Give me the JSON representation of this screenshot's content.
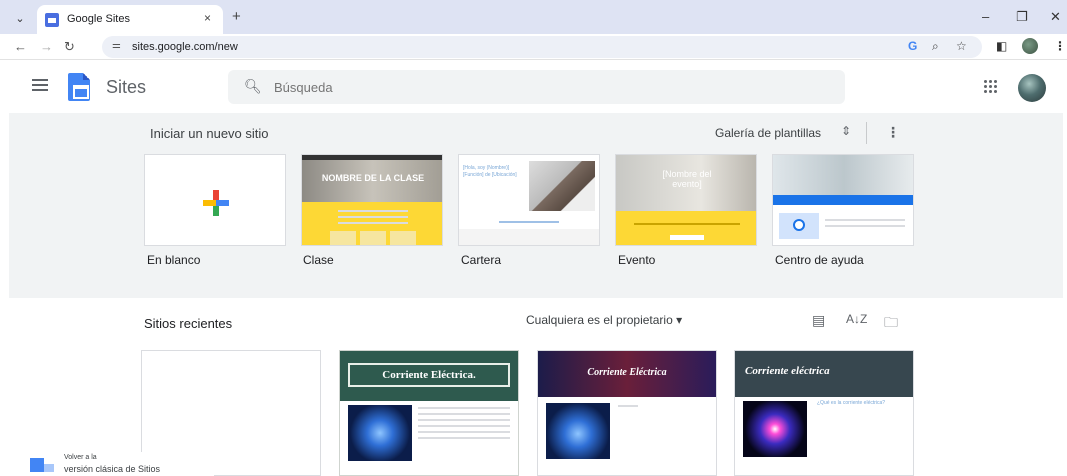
{
  "browser": {
    "tab_title": "Google Sites",
    "tab_close": "×",
    "new_tab": "+",
    "url": "sites.google.com/new",
    "window_controls": [
      "–",
      "❐",
      "✕"
    ],
    "toolbar_icons": [
      "google-g-icon",
      "zoom-icon",
      "bookmark-star-icon",
      "side-panel-icon",
      "profile-icon",
      "menu-kebab-icon"
    ]
  },
  "app": {
    "title": "Sites",
    "search_placeholder": "Búsqueda"
  },
  "new_site": {
    "heading": "Iniciar un nuevo sitio",
    "gallery_label": "Galería de plantillas",
    "templates": [
      {
        "label": "En blanco"
      },
      {
        "label": "Clase",
        "banner_text": "NOMBRE DE LA CLASE"
      },
      {
        "label": "Cartera",
        "side_text": "[Hola, soy (Nombre)] [Función] de [Ubicación]"
      },
      {
        "label": "Evento",
        "banner_text": "[Nombre del evento]"
      },
      {
        "label": "Centro de ayuda"
      }
    ]
  },
  "recent": {
    "heading": "Sitios recientes",
    "owner_filter": "Cualquiera es el propietario",
    "sites": [
      {
        "title": ""
      },
      {
        "title": "Corriente Eléctrica."
      },
      {
        "title": "Corriente Eléctrica"
      },
      {
        "title": "Corriente eléctrica",
        "subtitle": "¿Qué es la corriente eléctrica?"
      }
    ]
  },
  "classic": {
    "line1": "Volver a la",
    "line2": "versión clásica de Sitios"
  },
  "colors": {
    "tabbar": "#dee3f3",
    "accent_blue": "#4285f4",
    "section_bg": "#f1f3f4",
    "class_yellow": "#fdd835"
  }
}
